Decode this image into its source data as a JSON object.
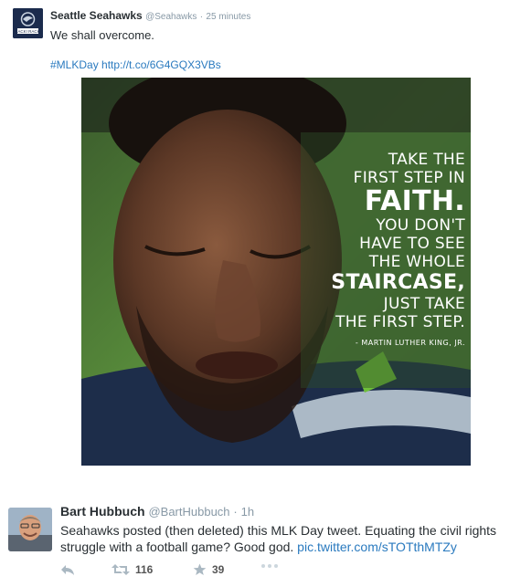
{
  "tweet1": {
    "display_name": "Seattle Seahawks",
    "handle": "@Seahawks",
    "separator": "·",
    "time": "25 minutes",
    "text": "We shall overcome.",
    "link": "#MLKDay http://t.co/6G4GQX3VBs",
    "avatar_label": "RACK! RACK!",
    "image": {
      "quote_lines": [
        "Take the",
        "first step in",
        "FAITH.",
        "You don't",
        "have to see",
        "the whole",
        "STAIRCASE,",
        "just take",
        "the first step."
      ],
      "attribution": "- MARTIN LUTHER KING, JR."
    }
  },
  "tweet2": {
    "display_name": "Bart Hubbuch",
    "handle": "@BartHubbuch",
    "separator": "·",
    "time": "1h",
    "text": "Seahawks posted (then deleted) this MLK Day tweet. Equating the civil rights struggle with a football game? Good god.",
    "pic_link": "pic.twitter.com/sTOTthMTZy",
    "actions": {
      "retweets": "116",
      "favorites": "39"
    }
  },
  "colors": {
    "link": "#2a7abf",
    "muted": "#8899a6",
    "text": "#292f33",
    "quote_green": "#4a8f3a"
  }
}
